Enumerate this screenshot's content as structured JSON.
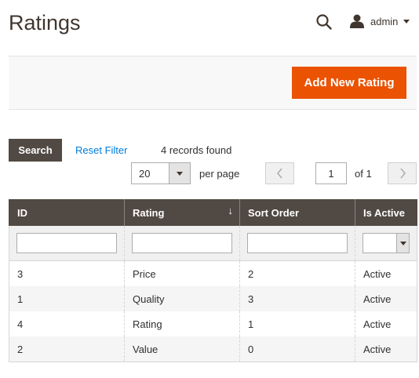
{
  "header": {
    "title": "Ratings",
    "user": {
      "name": "admin"
    }
  },
  "actions": {
    "add_label": "Add New Rating"
  },
  "filter_bar": {
    "search_label": "Search",
    "reset_label": "Reset Filter",
    "records_found": "4 records found"
  },
  "pager": {
    "page_size": "20",
    "per_page_label": "per page",
    "current_page": "1",
    "of_pages": "of 1"
  },
  "grid": {
    "columns": [
      {
        "label": "ID"
      },
      {
        "label": "Rating",
        "sort": "↓"
      },
      {
        "label": "Sort Order"
      },
      {
        "label": "Is Active"
      }
    ],
    "rows": [
      {
        "id": "3",
        "rating": "Price",
        "sort_order": "2",
        "is_active": "Active"
      },
      {
        "id": "1",
        "rating": "Quality",
        "sort_order": "3",
        "is_active": "Active"
      },
      {
        "id": "4",
        "rating": "Rating",
        "sort_order": "1",
        "is_active": "Active"
      },
      {
        "id": "2",
        "rating": "Value",
        "sort_order": "0",
        "is_active": "Active"
      }
    ]
  },
  "colors": {
    "accent": "#eb5202",
    "header_bg": "#514943",
    "link": "#007bdb"
  },
  "icons": {
    "search": "search-icon",
    "user": "user-icon",
    "prev": "chevron-left-icon",
    "next": "chevron-right-icon"
  }
}
